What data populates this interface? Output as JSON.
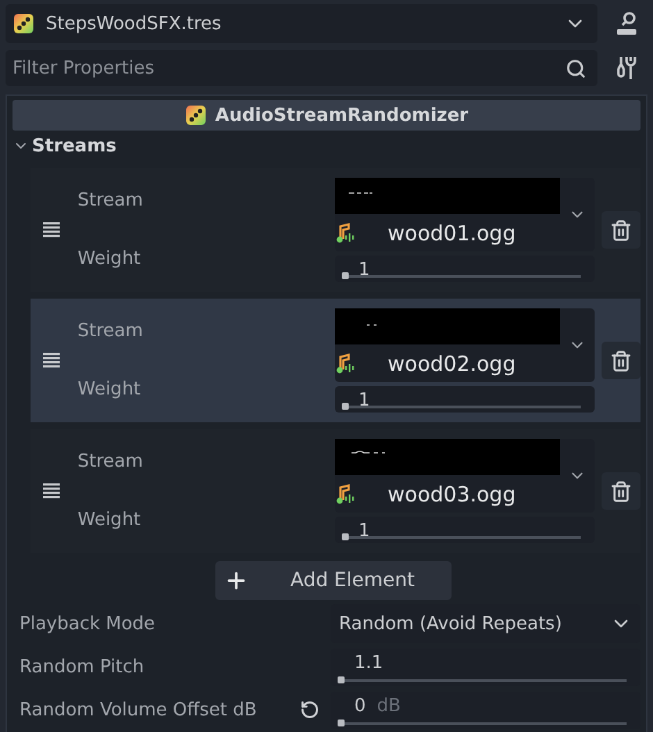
{
  "resource": {
    "name": "StepsWoodSFX.tres"
  },
  "filter": {
    "placeholder": "Filter Properties"
  },
  "inspector": {
    "class_name": "AudioStreamRandomizer",
    "section": {
      "label": "Streams",
      "expanded": true
    },
    "streams": [
      {
        "stream_label": "Stream",
        "file": "wood01.ogg",
        "weight_label": "Weight",
        "weight": "1",
        "level": 0,
        "highlighted": false
      },
      {
        "stream_label": "Stream",
        "file": "wood02.ogg",
        "weight_label": "Weight",
        "weight": "1",
        "level": 0,
        "highlighted": true
      },
      {
        "stream_label": "Stream",
        "file": "wood03.ogg",
        "weight_label": "Weight",
        "weight": "1",
        "level": 0,
        "highlighted": false
      }
    ],
    "add_button": "Add Element",
    "properties": [
      {
        "kind": "dropdown",
        "label": "Playback Mode",
        "value": "Random (Avoid Repeats)"
      },
      {
        "kind": "slider",
        "label": "Random Pitch",
        "value": "1.1",
        "level": 0
      },
      {
        "kind": "slider",
        "label": "Random Volume Offset dB",
        "value": "0",
        "unit": "dB",
        "level": 0,
        "revertable": true
      }
    ]
  }
}
